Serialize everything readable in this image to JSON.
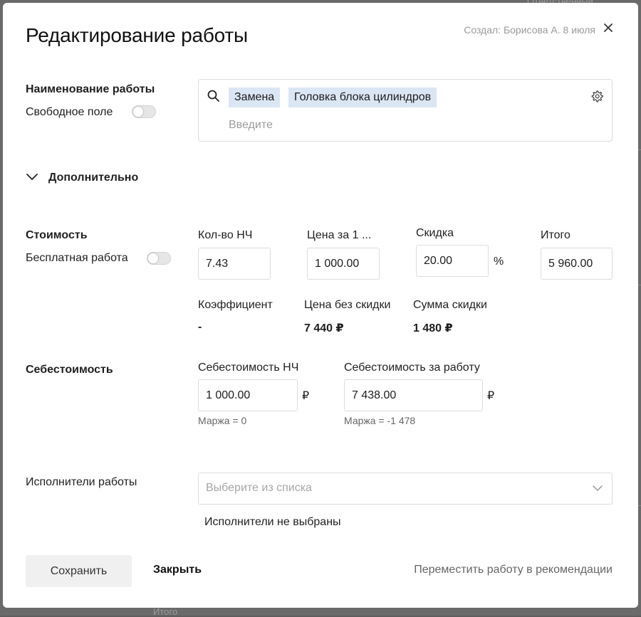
{
  "dialog": {
    "title": "Редактирование работы",
    "meta": "Создал: Борисова А. 8 июля"
  },
  "name_section": {
    "label": "Наименование работы",
    "free_field_label": "Свободное поле",
    "chips": [
      "Замена",
      "Головка блока цилиндров"
    ],
    "placeholder": "Введите"
  },
  "extra": {
    "label": "Дополнительно"
  },
  "cost": {
    "label": "Стоимость",
    "free_work_label": "Бесплатная работа",
    "qty_label": "Кол-во НЧ",
    "qty_value": "7.43",
    "price_label": "Цена за 1 ...",
    "price_value": "1 000.00",
    "discount_label": "Скидка",
    "discount_value": "20.00",
    "discount_unit": "%",
    "total_label": "Итого",
    "total_value": "5 960.00",
    "coef_label": "Коэффициент",
    "coef_value": "-",
    "nodiscount_label": "Цена без скидки",
    "nodiscount_value": "7 440 ₽",
    "discount_sum_label": "Сумма скидки",
    "discount_sum_value": "1 480 ₽"
  },
  "self_cost": {
    "label": "Себестоимость",
    "hour_label": "Себестоимость НЧ",
    "hour_value": "1 000.00",
    "hour_currency": "₽",
    "hour_margin": "Маржа = 0",
    "work_label": "Себестоимость за работу",
    "work_value": "7 438.00",
    "work_currency": "₽",
    "work_margin": "Маржа = -1 478"
  },
  "performers": {
    "label": "Исполнители работы",
    "placeholder": "Выберите из списка",
    "empty_text": "Исполнители не выбраны"
  },
  "footer": {
    "save": "Сохранить",
    "close": "Закрыть",
    "move": "Переместить работу в рекомендации"
  },
  "background": {
    "bottom_text": "Итого",
    "top_text": "Ответственный"
  },
  "colors": {
    "chip_bg": "#dbe6f4",
    "save_bg": "#f0f0f0"
  }
}
